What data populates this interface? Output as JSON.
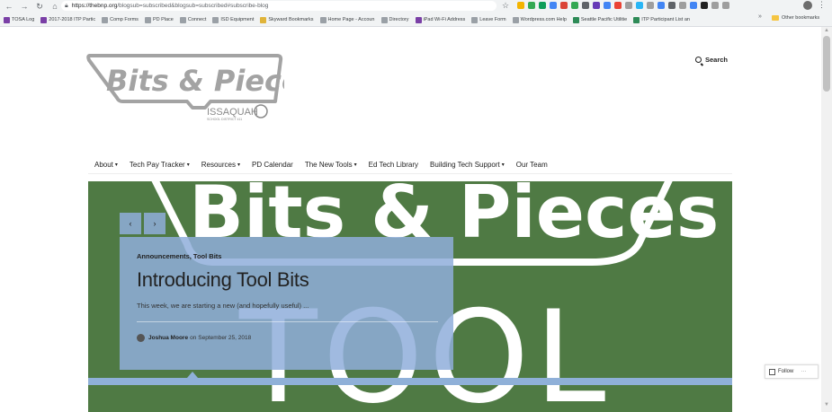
{
  "browser": {
    "url_host": "https://thebnp.org",
    "url_path": "/blogsub=subscribed&blogsub=subscribed#subscribe-blog",
    "bookmarks": [
      {
        "label": "TOSA Log",
        "color": "#7a3fa6"
      },
      {
        "label": "2017-2018 ITP Partic",
        "color": "#7a3fa6"
      },
      {
        "label": "Comp Forms",
        "color": "#9aa0a6"
      },
      {
        "label": "PD Place",
        "color": "#9aa0a6"
      },
      {
        "label": "Connect",
        "color": "#9aa0a6"
      },
      {
        "label": "ISD Equipment",
        "color": "#9aa0a6"
      },
      {
        "label": "Skyward Bookmarks",
        "color": "#e0b43a"
      },
      {
        "label": "Home Page - Accoun",
        "color": "#9aa0a6"
      },
      {
        "label": "Directory",
        "color": "#9aa0a6"
      },
      {
        "label": "iPad Wi-Fi Address",
        "color": "#7a3fa6"
      },
      {
        "label": "Leave Form",
        "color": "#9aa0a6"
      },
      {
        "label": "Wordpress.com Help",
        "color": "#9aa0a6"
      },
      {
        "label": "Seattle Pacific Utilitie",
        "color": "#2e8b57"
      },
      {
        "label": "ITP Participant List an",
        "color": "#2e8b57"
      }
    ],
    "bookmarks_more": "»",
    "other_bookmarks": "Other bookmarks",
    "extension_colors": [
      "#f4b400",
      "#34a853",
      "#0f9d58",
      "#4285f4",
      "#db4437",
      "#34a853",
      "#5f6368",
      "#673ab7",
      "#4285f4",
      "#ea4335",
      "#9e9e9e",
      "#29b6f6",
      "#9e9e9e",
      "#4285f4",
      "#5f6368",
      "#9e9e9e",
      "#4285f4",
      "#212121",
      "#9e9e9e",
      "#9e9e9e"
    ]
  },
  "site": {
    "logo_text": "Bits & Pieces",
    "logo_sub": "ISSAQUAH",
    "logo_sub2": "SCHOOL DISTRICT 411",
    "search_label": "Search"
  },
  "menu": [
    {
      "label": "About",
      "caret": "▾"
    },
    {
      "label": "Tech Pay Tracker",
      "caret": "▾"
    },
    {
      "label": "Resources",
      "caret": "▾"
    },
    {
      "label": "PD Calendar",
      "caret": ""
    },
    {
      "label": "The New Tools",
      "caret": "▾"
    },
    {
      "label": "Ed Tech Library",
      "caret": ""
    },
    {
      "label": "Building Tech Support",
      "caret": "▾"
    },
    {
      "label": "Our Team",
      "caret": ""
    }
  ],
  "hero": {
    "image_text_top": "Bits & Pieces",
    "image_text_bottom": "TOOL",
    "prev_label": "‹",
    "next_label": "›",
    "categories": "Announcements, Tool Bits",
    "title": "Introducing Tool Bits",
    "excerpt": "This week, we are starting a new (and hopefully useful) ...",
    "author": "Joshua Moore",
    "date_prefix": "on",
    "date": "September 25, 2018"
  },
  "follow": {
    "label": "Follow",
    "more": "···"
  }
}
